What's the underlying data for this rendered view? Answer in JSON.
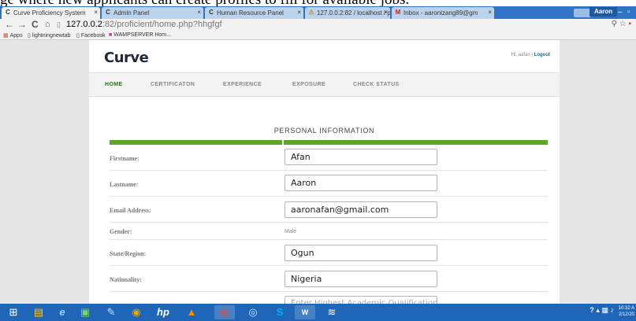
{
  "caption": "ge where new applicants can create profiles to fill for available jobs.",
  "browser": {
    "tabs": [
      {
        "title": "Curve Proficiency System",
        "icon": "C"
      },
      {
        "title": "Admin Panel",
        "icon": "C"
      },
      {
        "title": "Human Resource Panel",
        "icon": "C"
      },
      {
        "title": "127.0.0.2:82 / localhost / p",
        "icon": "⚠"
      },
      {
        "title": "Inbox - aaronizang89@gm",
        "icon": "M"
      }
    ],
    "profile_name": "Aaron",
    "url_host": "127.0.0.2",
    "url_rest": ":82/proficient/home.php?hhgfgf",
    "bookmarks": [
      "Apps",
      "lightningnewtab",
      "Facebook",
      "WAMPSERVER Hom..."
    ]
  },
  "site": {
    "brand": "Curve",
    "user_greeting": "Hi, aafan |",
    "logout": "Logout",
    "nav": [
      "HOME",
      "CERTIFICATON",
      "EXPERIENCE",
      "EXPOSURE",
      "CHECK STATUS"
    ],
    "section_title": "PERSONAL INFORMATION"
  },
  "form": {
    "firstname": {
      "label": "Firstname:",
      "value": "Afan"
    },
    "lastname": {
      "label": "Lastname:",
      "value": "Aaron"
    },
    "email": {
      "label": "Email Address:",
      "value": "aaronafan@gmail.com"
    },
    "gender": {
      "label": "Gender:",
      "value": "Male"
    },
    "state": {
      "label": "State/Region:",
      "value": "Ogun"
    },
    "nationality": {
      "label": "Nationality:",
      "value": "Nigeria"
    },
    "qualification": {
      "placeholder": "Enter Highest Academic Qualification"
    }
  },
  "taskbar": {
    "clock_time": "10:32 A",
    "clock_date": "2/12/20"
  },
  "colors": {
    "accent_green": "#5ea62a",
    "titlebar_blue": "#2f74c4",
    "taskbar_blue": "#1f66b8"
  }
}
